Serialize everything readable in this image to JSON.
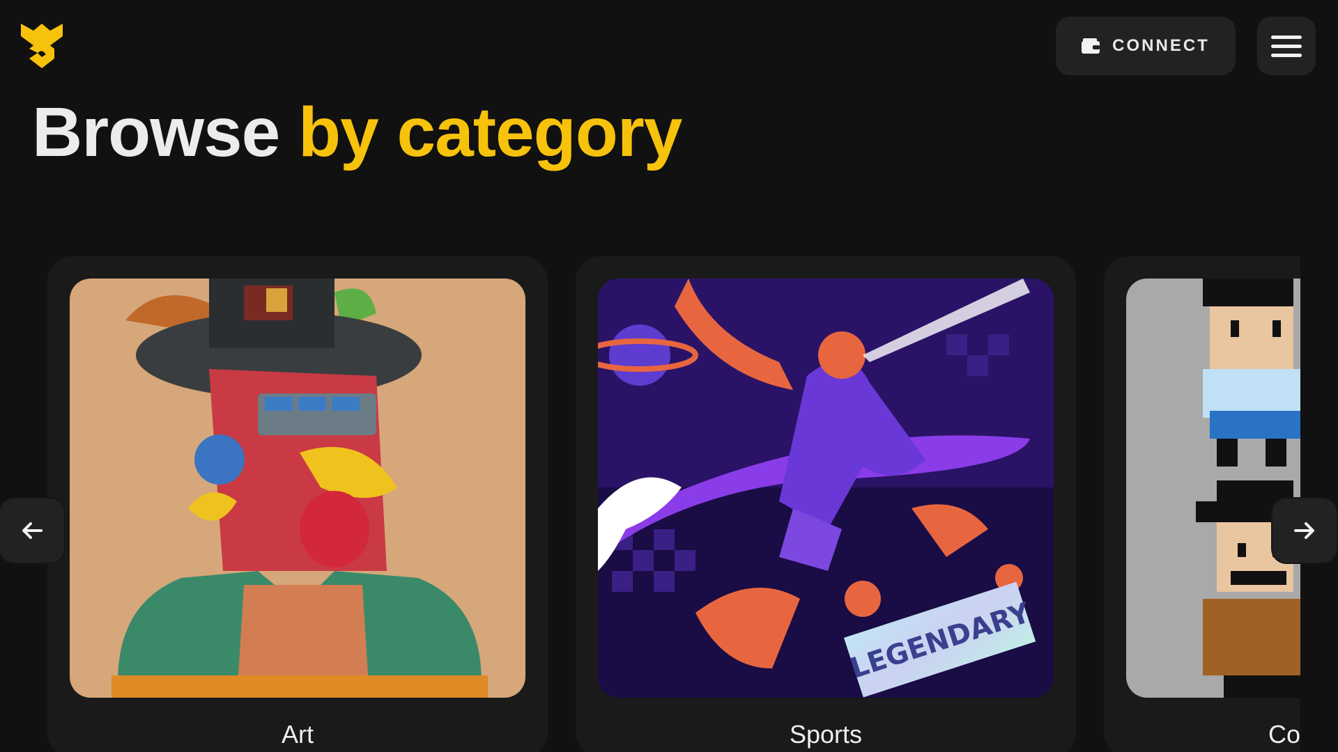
{
  "header": {
    "logo_icon": "brand-logo-icon",
    "connect_label": "CONNECT",
    "connect_icon": "wallet-icon",
    "menu_icon": "hamburger-menu-icon"
  },
  "heading": {
    "part1": "Browse",
    "part2": "by category"
  },
  "colors": {
    "accent": "#f7c20b",
    "background": "#111111",
    "card": "#1a1a1a",
    "button": "#222222"
  },
  "carousel": {
    "prev_icon": "arrow-left-icon",
    "next_icon": "arrow-right-icon",
    "categories": [
      {
        "label": "Art"
      },
      {
        "label": "Sports"
      },
      {
        "label": "Co"
      }
    ]
  }
}
